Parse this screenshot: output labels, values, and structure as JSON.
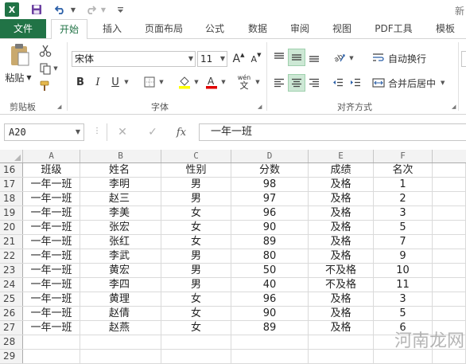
{
  "titlebar": {
    "app_icon": "excel-logo",
    "app_icon_letter": "X",
    "title_partial": "新"
  },
  "tabs": [
    {
      "label": "文件"
    },
    {
      "label": "开始"
    },
    {
      "label": "插入"
    },
    {
      "label": "页面布局"
    },
    {
      "label": "公式"
    },
    {
      "label": "数据"
    },
    {
      "label": "审阅"
    },
    {
      "label": "视图"
    },
    {
      "label": "PDF工具"
    },
    {
      "label": "模板"
    }
  ],
  "ribbon": {
    "clipboard": {
      "paste_label": "粘贴",
      "group_label": "剪贴板"
    },
    "font": {
      "font_name": "宋体",
      "font_size": "11",
      "bold": "B",
      "italic": "I",
      "underline": "U",
      "grow": "A",
      "shrink": "A",
      "wen": "wén",
      "group_label": "字体"
    },
    "alignment": {
      "wrap_label": "自动换行",
      "merge_label": "合并后居中",
      "group_label": "对齐方式"
    }
  },
  "formula_bar": {
    "name_box": "A20",
    "fx": "fx",
    "content": "一年一班"
  },
  "columns": [
    "A",
    "B",
    "C",
    "D",
    "E",
    "F"
  ],
  "rows": [
    {
      "num": "16",
      "cells": [
        "班级",
        "姓名",
        "性别",
        "分数",
        "成绩",
        "名次"
      ]
    },
    {
      "num": "17",
      "cells": [
        "一年一班",
        "李明",
        "男",
        "98",
        "及格",
        "1"
      ]
    },
    {
      "num": "18",
      "cells": [
        "一年一班",
        "赵三",
        "男",
        "97",
        "及格",
        "2"
      ]
    },
    {
      "num": "19",
      "cells": [
        "一年一班",
        "李美",
        "女",
        "96",
        "及格",
        "3"
      ]
    },
    {
      "num": "20",
      "cells": [
        "一年一班",
        "张宏",
        "女",
        "90",
        "及格",
        "5"
      ]
    },
    {
      "num": "21",
      "cells": [
        "一年一班",
        "张红",
        "女",
        "89",
        "及格",
        "7"
      ]
    },
    {
      "num": "22",
      "cells": [
        "一年一班",
        "李武",
        "男",
        "80",
        "及格",
        "9"
      ]
    },
    {
      "num": "23",
      "cells": [
        "一年一班",
        "黄宏",
        "男",
        "50",
        "不及格",
        "10"
      ]
    },
    {
      "num": "24",
      "cells": [
        "一年一班",
        "李四",
        "男",
        "40",
        "不及格",
        "11"
      ]
    },
    {
      "num": "25",
      "cells": [
        "一年一班",
        "黄理",
        "女",
        "96",
        "及格",
        "3"
      ]
    },
    {
      "num": "26",
      "cells": [
        "一年一班",
        "赵倩",
        "女",
        "90",
        "及格",
        "5"
      ]
    },
    {
      "num": "27",
      "cells": [
        "一年一班",
        "赵燕",
        "女",
        "89",
        "及格",
        "6"
      ]
    },
    {
      "num": "28",
      "cells": [
        "",
        "",
        "",
        "",
        "",
        ""
      ]
    },
    {
      "num": "29",
      "cells": [
        "",
        "",
        "",
        "",
        "",
        ""
      ]
    }
  ],
  "watermark": "河南龙网",
  "colors": {
    "accent": "#217346",
    "selected_align": "#cde8d5",
    "header_bg": "#f3f3f3"
  }
}
